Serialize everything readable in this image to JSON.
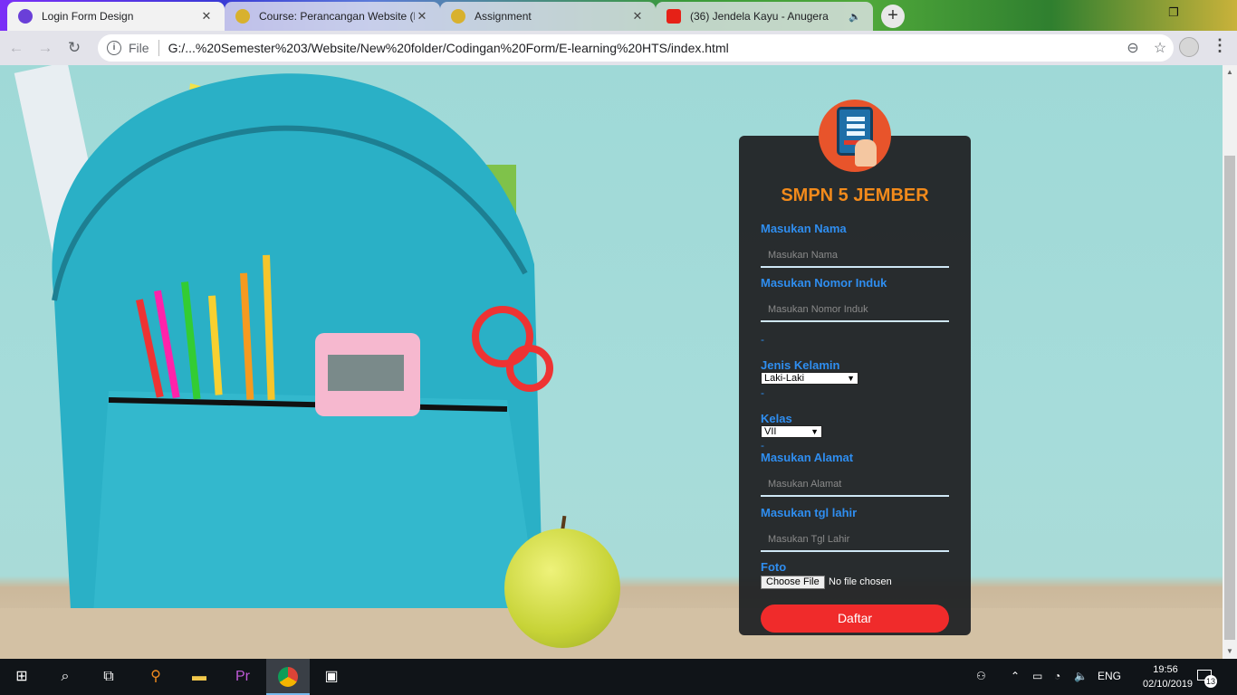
{
  "browser": {
    "tabs": [
      {
        "title": "Login Form Design",
        "active": true
      },
      {
        "title": "Course: Perancangan Website (E",
        "active": false
      },
      {
        "title": "Assignment",
        "active": false
      },
      {
        "title": "(36) Jendela Kayu - Anugera",
        "active": false
      }
    ],
    "new_tab_label": "+",
    "close_label": "✕",
    "nav": {
      "back": "←",
      "forward": "→",
      "reload": "↻"
    },
    "address": {
      "scheme_label": "File",
      "url": "G:/...%20Semester%203/Website/New%20folder/Codingan%20Form/E-learning%20HTS/index.html"
    }
  },
  "form": {
    "school_name": "SMPN 5 JEMBER",
    "name_label": "Masukan Nama",
    "name_placeholder": "Masukan Nama",
    "nis_label": "Masukan Nomor Induk",
    "nis_placeholder": "Masukan Nomor Induk",
    "dash": "-",
    "gender_label": "Jenis Kelamin",
    "gender_selected": "Laki-Laki",
    "class_label": "Kelas",
    "class_selected": "VII",
    "address_label": "Masukan Alamat",
    "address_placeholder": "Masukan Alamat",
    "dob_label": "Masukan tgl lahir",
    "dob_placeholder": "Masukan Tgl Lahir",
    "photo_label": "Foto",
    "choose_file_label": "Choose File",
    "no_file_label": "No file chosen",
    "submit_label": "Daftar"
  },
  "taskbar": {
    "lang": "ENG",
    "time": "19:56",
    "date": "02/10/2019",
    "notification_count": "13"
  }
}
